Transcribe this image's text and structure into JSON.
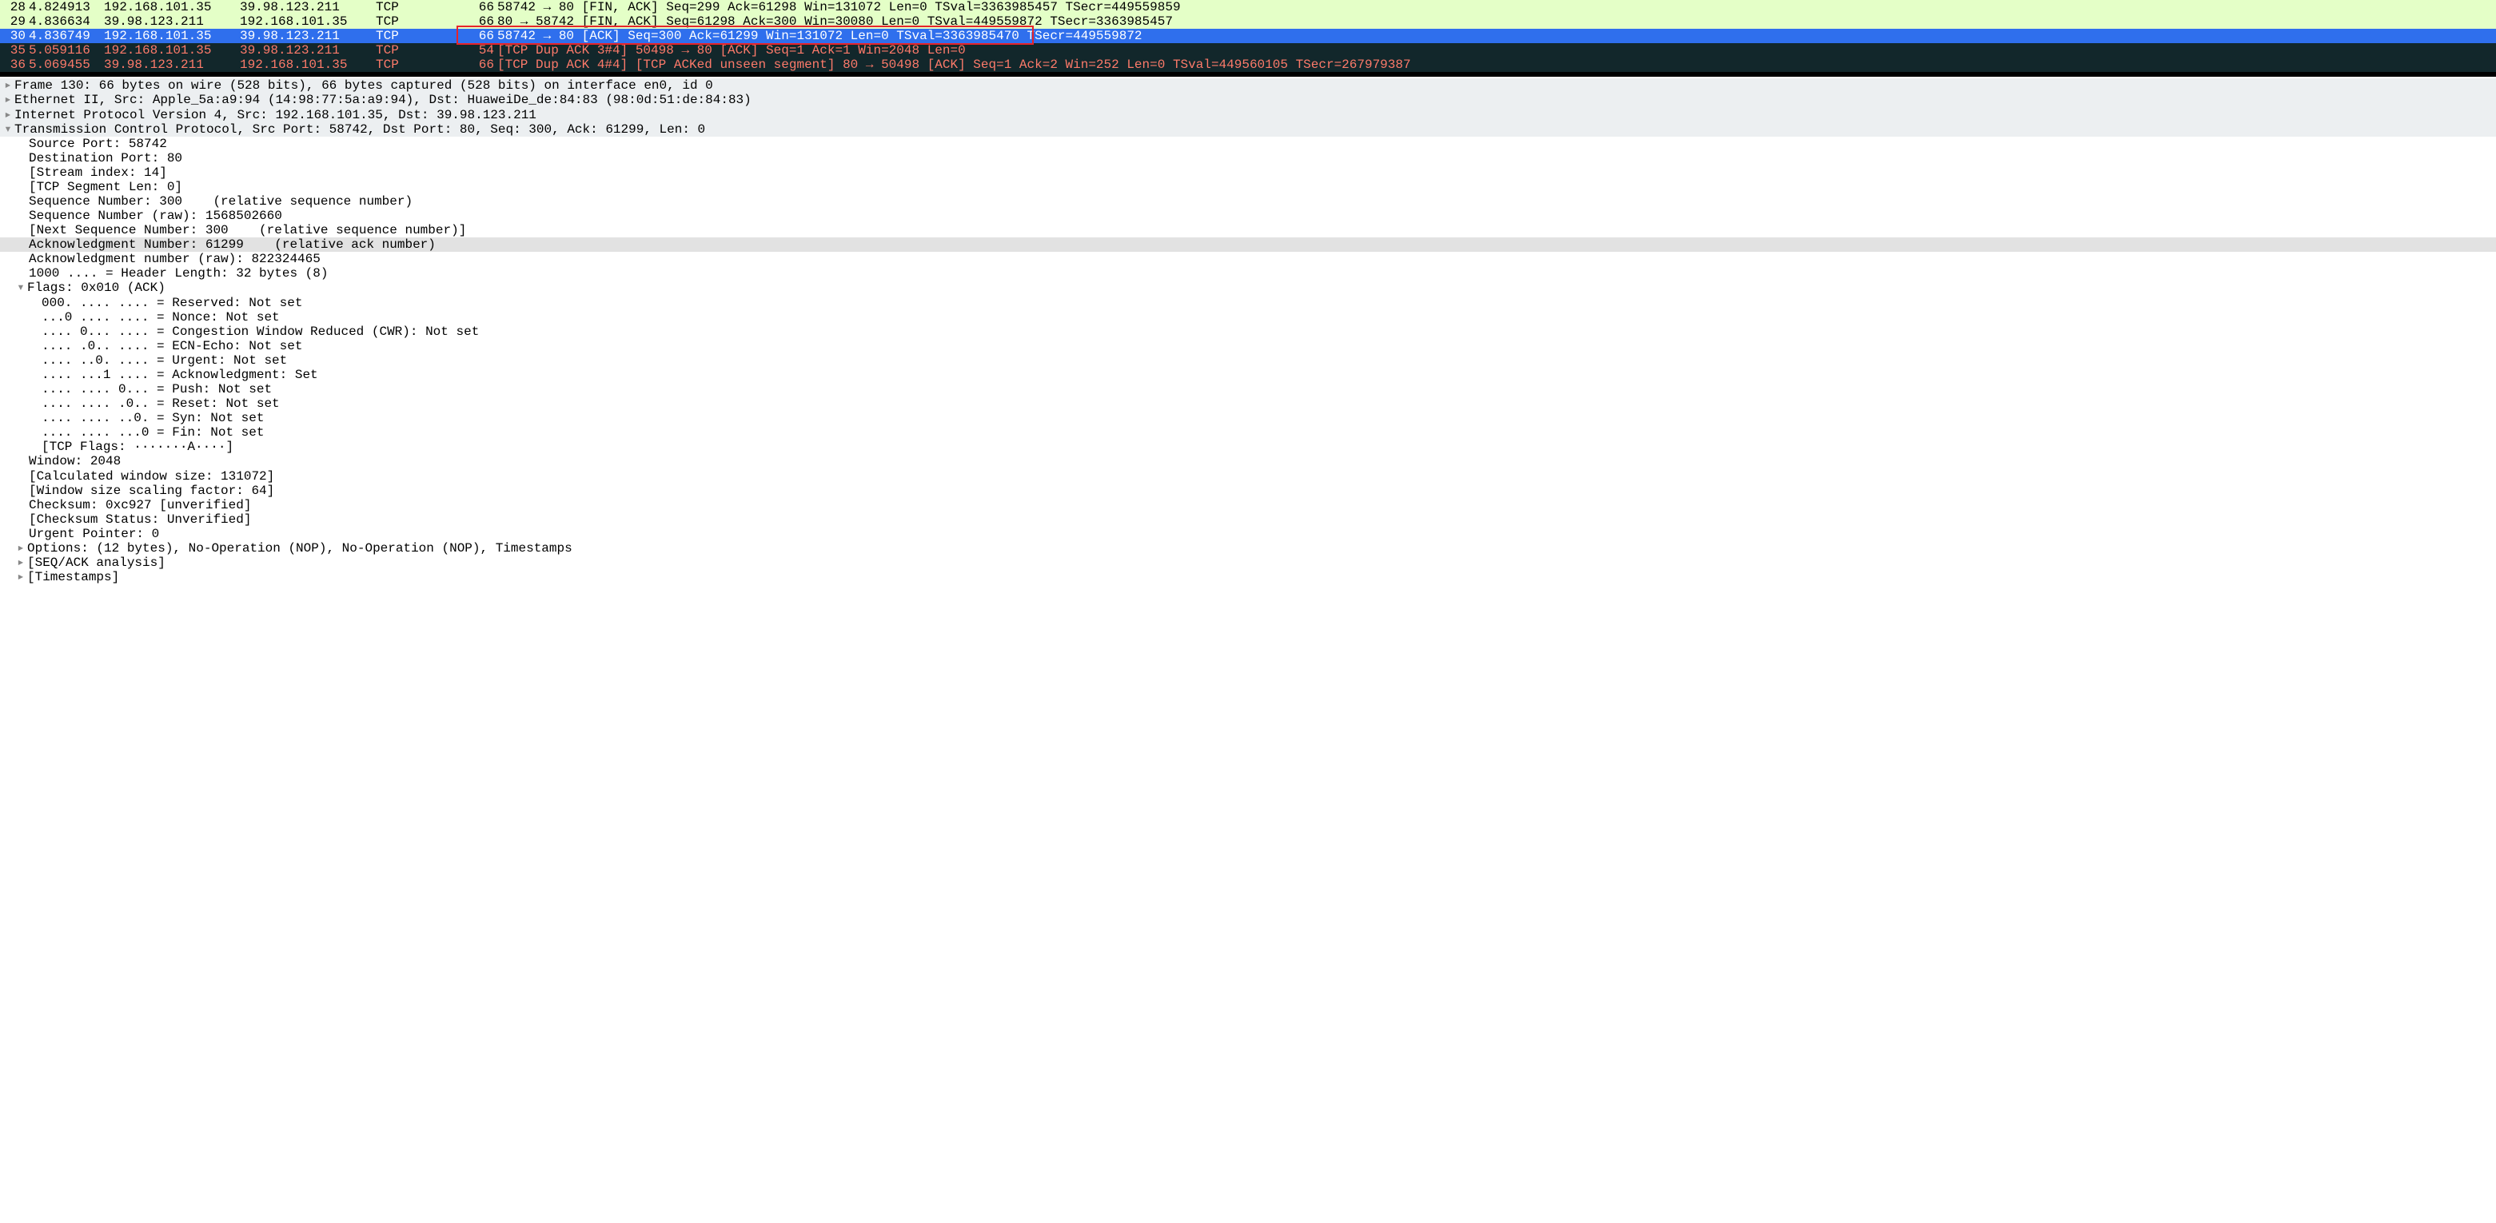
{
  "packets": [
    {
      "style": "green",
      "no": "28",
      "time": "4.824913",
      "src": "192.168.101.35",
      "dst": "39.98.123.211",
      "proto": "TCP",
      "len": "66",
      "info": "58742 → 80 [FIN, ACK] Seq=299 Ack=61298 Win=131072 Len=0 TSval=3363985457 TSecr=449559859"
    },
    {
      "style": "green",
      "no": "29",
      "time": "4.836634",
      "src": "39.98.123.211",
      "dst": "192.168.101.35",
      "proto": "TCP",
      "len": "66",
      "info": "80 → 58742 [FIN, ACK] Seq=61298 Ack=300 Win=30080 Len=0 TSval=449559872 TSecr=3363985457"
    },
    {
      "style": "selected",
      "no": "30",
      "time": "4.836749",
      "src": "192.168.101.35",
      "dst": "39.98.123.211",
      "proto": "TCP",
      "len": "66",
      "info": "58742 → 80 [ACK] Seq=300 Ack=61299 Win=131072 Len=0 TSval=3363985470 TSecr=449559872"
    },
    {
      "style": "dark",
      "no": "35",
      "time": "5.059116",
      "src": "192.168.101.35",
      "dst": "39.98.123.211",
      "proto": "TCP",
      "len": "54",
      "info": "[TCP Dup ACK 3#4] 50498 → 80 [ACK] Seq=1 Ack=1 Win=2048 Len=0"
    },
    {
      "style": "dark",
      "no": "36",
      "time": "5.069455",
      "src": "39.98.123.211",
      "dst": "192.168.101.35",
      "proto": "TCP",
      "len": "66",
      "info": "[TCP Dup ACK 4#4] [TCP ACKed unseen segment] 80 → 50498 [ACK] Seq=1 Ack=2 Win=252 Len=0 TSval=449560105 TSecr=267979387"
    }
  ],
  "details": {
    "frame": "Frame 130: 66 bytes on wire (528 bits), 66 bytes captured (528 bits) on interface en0, id 0",
    "eth": "Ethernet II, Src: Apple_5a:a9:94 (14:98:77:5a:a9:94), Dst: HuaweiDe_de:84:83 (98:0d:51:de:84:83)",
    "ip": "Internet Protocol Version 4, Src: 192.168.101.35, Dst: 39.98.123.211",
    "tcp": "Transmission Control Protocol, Src Port: 58742, Dst Port: 80, Seq: 300, Ack: 61299, Len: 0",
    "srcport": "Source Port: 58742",
    "dstport": "Destination Port: 80",
    "stream": "[Stream index: 14]",
    "seglen": "[TCP Segment Len: 0]",
    "seq": "Sequence Number: 300    (relative sequence number)",
    "seqraw": "Sequence Number (raw): 1568502660",
    "nextseq": "[Next Sequence Number: 300    (relative sequence number)]",
    "ack": "Acknowledgment Number: 61299    (relative ack number)",
    "ackraw": "Acknowledgment number (raw): 822324465",
    "hlen": "1000 .... = Header Length: 32 bytes (8)",
    "flags": "Flags: 0x010 (ACK)",
    "f_res": "000. .... .... = Reserved: Not set",
    "f_nonce": "...0 .... .... = Nonce: Not set",
    "f_cwr": ".... 0... .... = Congestion Window Reduced (CWR): Not set",
    "f_ece": ".... .0.. .... = ECN-Echo: Not set",
    "f_urg": ".... ..0. .... = Urgent: Not set",
    "f_ack": ".... ...1 .... = Acknowledgment: Set",
    "f_psh": ".... .... 0... = Push: Not set",
    "f_rst": ".... .... .0.. = Reset: Not set",
    "f_syn": ".... .... ..0. = Syn: Not set",
    "f_fin": ".... .... ...0 = Fin: Not set",
    "f_str": "[TCP Flags: ·······A····]",
    "win": "Window: 2048",
    "calcwin": "[Calculated window size: 131072]",
    "winscale": "[Window size scaling factor: 64]",
    "chksum": "Checksum: 0xc927 [unverified]",
    "chkstat": "[Checksum Status: Unverified]",
    "urgptr": "Urgent Pointer: 0",
    "options": "Options: (12 bytes), No-Operation (NOP), No-Operation (NOP), Timestamps",
    "seqack": "[SEQ/ACK analysis]",
    "timestamps": "[Timestamps]"
  }
}
